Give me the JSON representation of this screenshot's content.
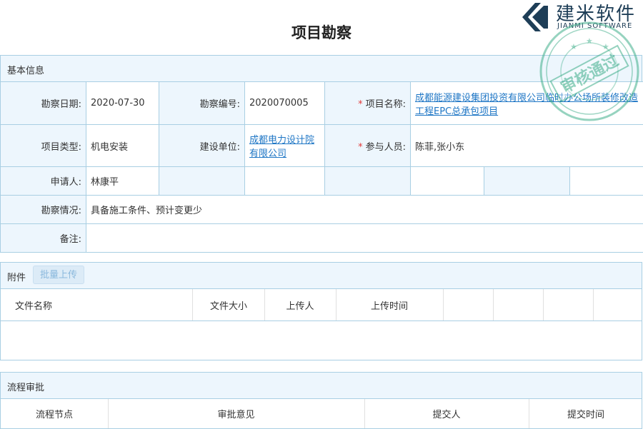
{
  "page": {
    "title": "项目勘察"
  },
  "brand": {
    "name_cn": "建米软件",
    "name_en": "JIANMI SOFTWARE",
    "stamp_text": "审核通过"
  },
  "basic": {
    "section_title": "基本信息",
    "survey_date_label": "勘察日期:",
    "survey_date": "2020-07-30",
    "survey_no_label": "勘察编号:",
    "survey_no": "2020070005",
    "project_name_label": "项目名称:",
    "project_name": "成都能源建设集团投资有限公司临时办公场所装修改造工程EPC总承包项目",
    "project_type_label": "项目类型:",
    "project_type": "机电安装",
    "builder_label": "建设单位:",
    "builder": "成都电力设计院有限公司",
    "participants_label": "参与人员:",
    "participants": "陈菲,张小东",
    "applicant_label": "申请人:",
    "applicant": "林康平",
    "situation_label": "勘察情况:",
    "situation": "具备施工条件、预计变更少",
    "remark_label": "备注:",
    "remark": ""
  },
  "attachments": {
    "section_title": "附件",
    "upload_button": "批量上传",
    "columns": [
      "文件名称",
      "文件大小",
      "上传人",
      "上传时间"
    ]
  },
  "workflow": {
    "section_title": "流程审批",
    "columns": [
      "流程节点",
      "审批意见",
      "提交人",
      "提交时间"
    ]
  },
  "colors": {
    "link": "#1e76c5",
    "label_bg": "#edf6fd",
    "border": "#a9cfe3",
    "required": "#e23b3b",
    "stamp": "#3fae8a"
  }
}
